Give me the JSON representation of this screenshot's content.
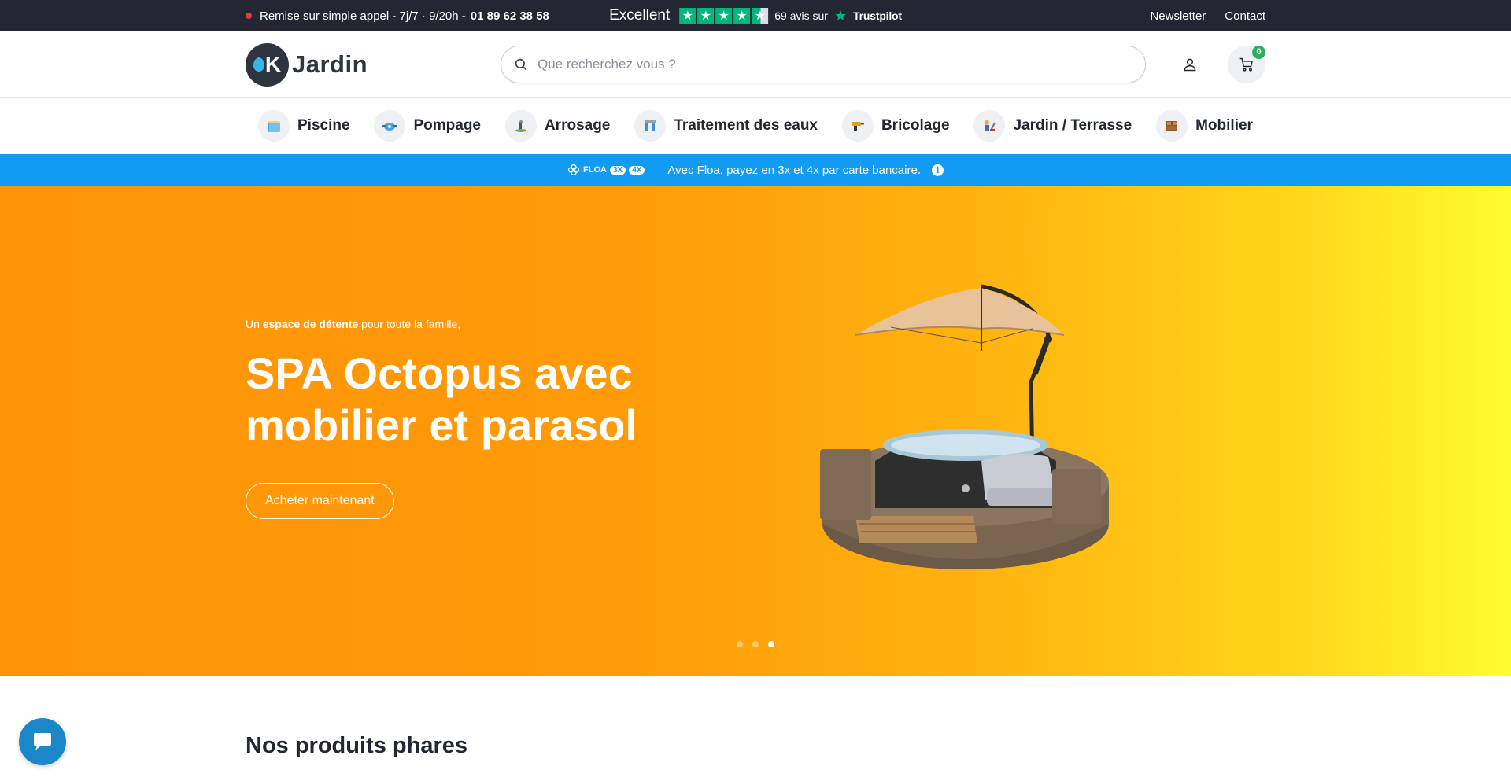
{
  "topbar": {
    "call_text": "Remise sur simple appel  - 7j/7 · 9/20h -",
    "phone": "01 89 62 38 58",
    "rating_word": "Excellent",
    "stars": 4.5,
    "reviews_text": "69 avis sur",
    "trustpilot": "Trustpilot",
    "links": {
      "newsletter": "Newsletter",
      "contact": "Contact"
    }
  },
  "header": {
    "logo_letter": "K",
    "logo_text": "Jardin",
    "search_placeholder": "Que recherchez vous ?",
    "cart_count": "0"
  },
  "nav": {
    "items": [
      {
        "label": "Piscine",
        "icon": "pool-icon"
      },
      {
        "label": "Pompage",
        "icon": "pump-icon"
      },
      {
        "label": "Arrosage",
        "icon": "sprinkler-icon"
      },
      {
        "label": "Traitement des eaux",
        "icon": "water-filter-icon"
      },
      {
        "label": "Bricolage",
        "icon": "drill-icon"
      },
      {
        "label": "Jardin / Terrasse",
        "icon": "garden-icon"
      },
      {
        "label": "Mobilier",
        "icon": "furniture-icon"
      }
    ]
  },
  "floa": {
    "brand": "FLOA",
    "pill_3x": "3X",
    "pill_4x": "4X",
    "text": "Avec Floa, payez en 3x et 4x par carte bancaire."
  },
  "hero": {
    "sub_before": "Un ",
    "sub_bold": "espace de détente",
    "sub_after": " pour toute la famille,",
    "title": "SPA Octopus avec mobilier et parasol",
    "button": "Acheter maintenant",
    "slides": 3,
    "active_slide": 3
  },
  "products": {
    "title": "Nos produits phares"
  },
  "colors": {
    "topbar_bg": "#222733",
    "floa_bg": "#119bf2",
    "hero_start": "#ff9407",
    "hero_end": "#fdfd2e",
    "trustpilot_green": "#00b67a",
    "badge_green": "#2eae5f",
    "chat_blue": "#1b87c9"
  }
}
